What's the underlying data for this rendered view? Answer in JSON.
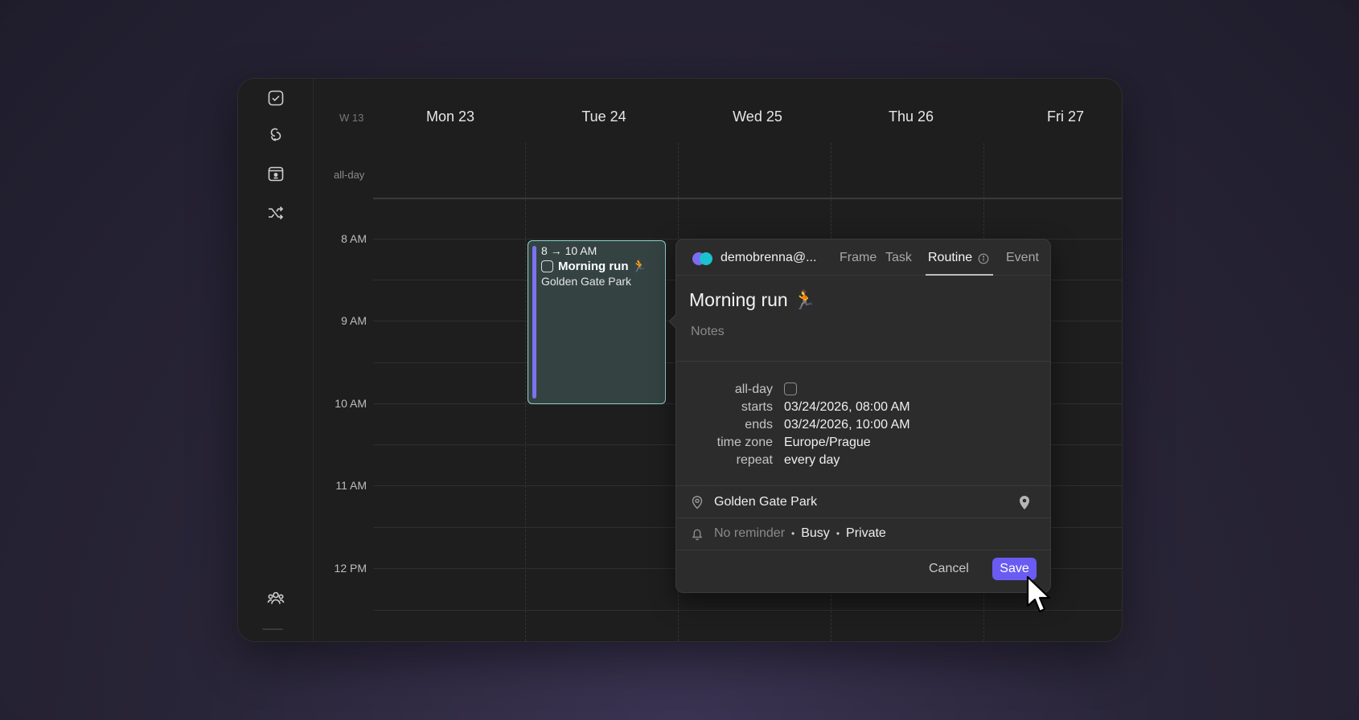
{
  "sidebar": {
    "icons": [
      "checkbox-icon",
      "link-icon",
      "calendar-person-icon",
      "shuffle-icon",
      "people-icon"
    ]
  },
  "calendar": {
    "week": "W 13",
    "days": [
      "Mon 23",
      "Tue 24",
      "Wed 25",
      "Thu 26",
      "Fri 27"
    ],
    "allday_label": "all-day",
    "hours": [
      "8 AM",
      "9 AM",
      "10 AM",
      "11 AM",
      "12 PM"
    ]
  },
  "event": {
    "time": "8 → 10 AM",
    "title": "Morning run 🏃",
    "location": "Golden Gate Park",
    "accent_color": "#7b73f0",
    "border_color": "#8fd2cb"
  },
  "popover": {
    "account": "demobrenna@...",
    "tabs": [
      "Frame",
      "Task",
      "Routine",
      "Event"
    ],
    "active_tab": "Routine",
    "title": "Morning run 🏃",
    "notes_placeholder": "Notes",
    "fields": {
      "allday_label": "all-day",
      "starts_label": "starts",
      "starts_value": "03/24/2026, 08:00 AM",
      "ends_label": "ends",
      "ends_value": "03/24/2026, 10:00 AM",
      "timezone_label": "time zone",
      "timezone_value": "Europe/Prague",
      "repeat_label": "repeat",
      "repeat_value": "every day"
    },
    "location": "Golden Gate Park",
    "reminder": "No reminder",
    "availability": "Busy",
    "visibility": "Private",
    "cancel_label": "Cancel",
    "save_label": "Save",
    "save_color": "#6a5cf2"
  }
}
